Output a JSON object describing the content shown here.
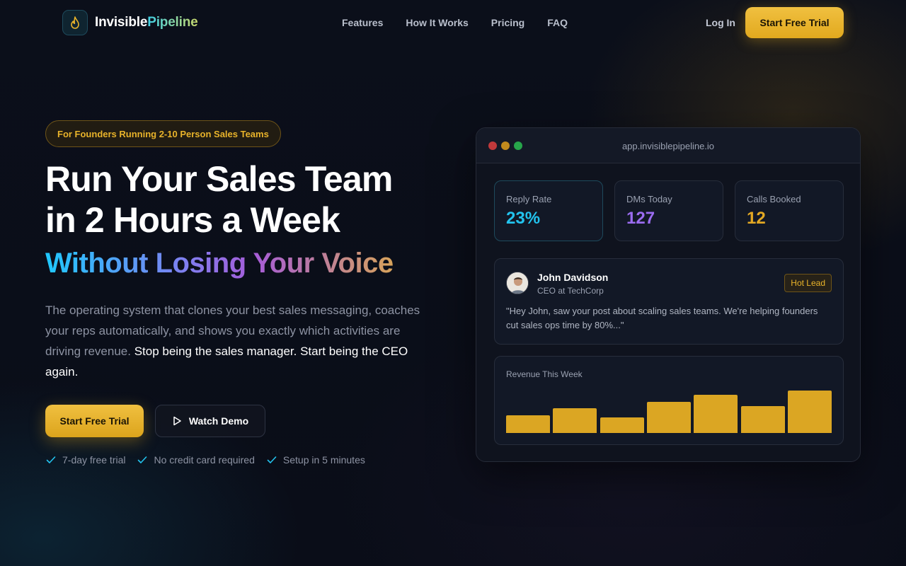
{
  "nav": {
    "logo_part1": "Invisible",
    "logo_part2": "Pipeline",
    "links": [
      "Features",
      "How It Works",
      "Pricing",
      "FAQ"
    ],
    "login": "Log In",
    "cta": "Start Free Trial"
  },
  "hero": {
    "badge": "For Founders Running 2-10 Person Sales Teams",
    "title_line1": "Run Your Sales Team",
    "title_line2": "in 2 Hours a Week",
    "subtitle": "Without Losing Your Voice",
    "description": "The operating system that clones your best sales messaging, coaches your reps automatically, and shows you exactly which activities are driving revenue. ",
    "description_highlight": "Stop being the sales manager. Start being the CEO again.",
    "cta_primary": "Start Free Trial",
    "cta_secondary": "Watch Demo",
    "perks": [
      "7-day free trial",
      "No credit card required",
      "Setup in 5 minutes"
    ]
  },
  "mockup": {
    "url": "app.invisiblepipeline.io",
    "stats": [
      {
        "label": "Reply Rate",
        "value": "23%",
        "color": "#22c3ee"
      },
      {
        "label": "DMs Today",
        "value": "127",
        "color": "#9b6cf0"
      },
      {
        "label": "Calls Booked",
        "value": "12",
        "color": "#e3a823"
      }
    ],
    "message": {
      "name": "John Davidson",
      "role": "CEO at TechCorp",
      "tag": "Hot Lead",
      "text": "\"Hey John, saw your post about scaling sales teams. We're helping founders cut sales ops time by 80%...\""
    },
    "revenue": {
      "title": "Revenue This Week",
      "bar_levels": [
        0.42,
        0.58,
        0.37,
        0.73,
        0.9,
        0.63,
        1.0
      ]
    }
  },
  "colors": {
    "accent_gold": "#e8b32a",
    "accent_cyan": "#22c3ee",
    "accent_purple": "#9b6cf0"
  }
}
